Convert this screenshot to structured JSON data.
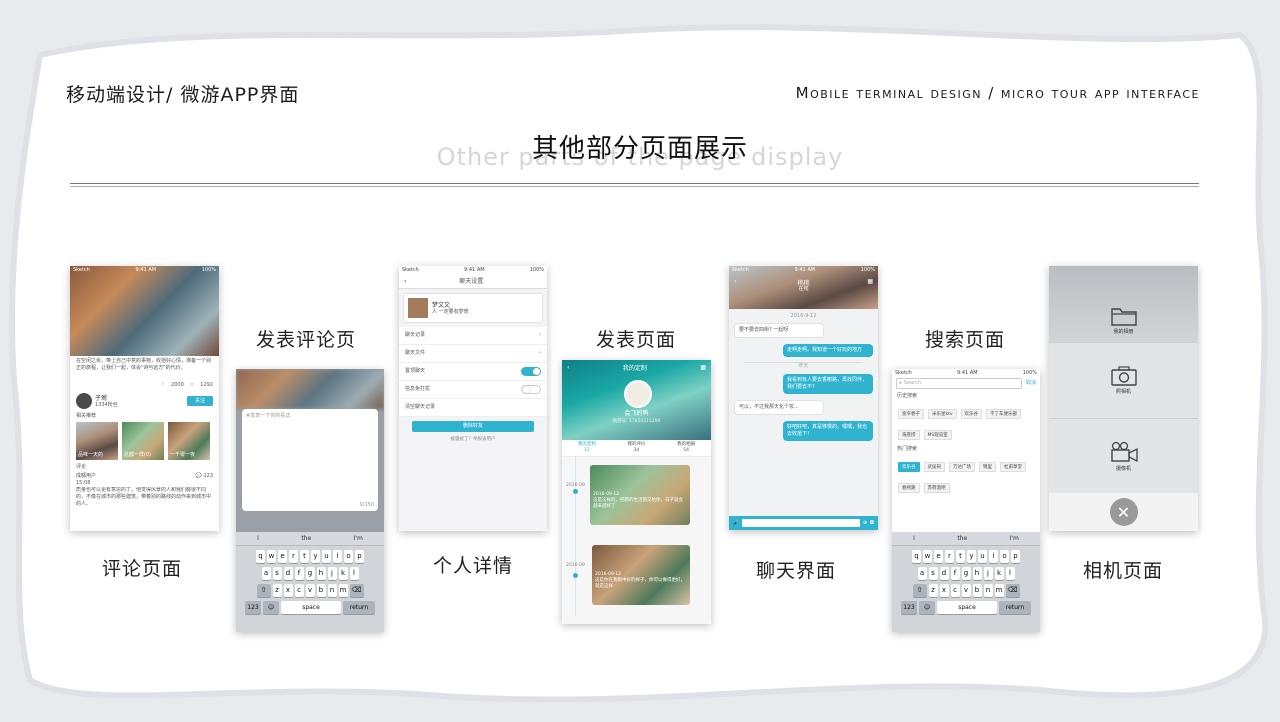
{
  "header": {
    "left_title": "移动端设计/ 微游APP界面",
    "right_title": "Mobile terminal design / micro tour app interface",
    "main_title": "其他部分页面展示",
    "main_subtitle": "Other parts of the page display"
  },
  "page_labels": {
    "comment_page": "评论页面",
    "post_comment_page": "发表评论页",
    "profile_detail": "个人详情",
    "publish_page": "发表页面",
    "chat_page": "聊天界面",
    "search_page": "搜索页面",
    "camera_page": "相机页面"
  },
  "status_bar": {
    "carrier": "Sketch",
    "time": "9:41 AM",
    "battery": "100%"
  },
  "comment_screen": {
    "intro_text": "在空闲之余，带上自己中意的事物，收拾好心情，准备一个别正的旅程，让我们一起，体会\"诗与远方\"的代价。",
    "likes": "2000",
    "stars": "1292",
    "user_name": "子莺",
    "user_fans": "1334粉丝",
    "follow_button": "关注",
    "related_title": "相关推荐",
    "related": [
      "品味一天的",
      "这都一样(0)",
      "一千零一夜"
    ],
    "comments_title": "评论",
    "commenter": "成都用户",
    "comment_time": "15:08",
    "comment_count": "123",
    "comment_text": "质量也可以更有意思的了。他觉得风景的人和我们都很不同的，不像在城市的那些建筑，带着别的路线的动作来到城市中的人。"
  },
  "post_comment_screen": {
    "placeholder": "#发表一下你的看法",
    "counter": "9/150"
  },
  "keyboard": {
    "suggestions": [
      "I",
      "the",
      "I'm"
    ],
    "row1": [
      "q",
      "w",
      "e",
      "r",
      "t",
      "y",
      "u",
      "i",
      "o",
      "p"
    ],
    "row2": [
      "a",
      "s",
      "d",
      "f",
      "g",
      "h",
      "j",
      "k",
      "l"
    ],
    "row3": [
      "z",
      "x",
      "c",
      "v",
      "b",
      "n",
      "m"
    ],
    "num_key": "123",
    "space": "space",
    "return": "return"
  },
  "profile_screen": {
    "nav_title": "聊天设置",
    "name": "梦文文",
    "signature": "人 一定要有梦想",
    "rows": [
      "聊天记录",
      "聊天文件",
      "置顶聊天",
      "信息免打扰",
      "清空聊天记录"
    ],
    "toggles": {
      "pin": true,
      "mute": false
    },
    "delete_button": "删除好友",
    "report_text": "被骚扰了？举报该用户"
  },
  "publish_screen": {
    "title": "我的定制",
    "user_name": "会飞的鸭",
    "phone": "微游号: 17850215290",
    "tabs": [
      {
        "label": "我的定制",
        "count": "12"
      },
      {
        "label": "我的评价",
        "count": "34"
      },
      {
        "label": "我的相册",
        "count": "54"
      }
    ],
    "timeline": [
      {
        "date": "2016-09",
        "card_date": "2016-09-12",
        "text": "这是这样的，把新的生活都交给你，日子就会越来越好了"
      },
      {
        "date": "2016-09",
        "card_date": "2016-09-12",
        "text": "这是你在我眼中好的样子，你可以做得更好，就是这样"
      }
    ]
  },
  "chat_screen": {
    "contact": "桃桃",
    "contact_status": "在线",
    "date": "2016-9-12",
    "divider": "昨天",
    "messages": [
      {
        "side": "left",
        "text": "要不要去四街? 一起呀"
      },
      {
        "side": "right",
        "text": "走啊走啊。我知道一个好玩的地方"
      },
      {
        "side": "right",
        "text": "我看到有人要去香榭路，再找同伴，我们要去不?"
      },
      {
        "side": "left",
        "text": "可以，不过我那天化个妆..."
      },
      {
        "side": "right",
        "text": "好吧好吧，真是够慢的。嘿嘿，我也去收拾下！"
      }
    ]
  },
  "search_screen": {
    "placeholder": "Search",
    "cancel": "取消",
    "history_title": "历史搜索",
    "history": [
      "宽窄巷子",
      "米乐星ktv",
      "欢乐谷",
      "不了车便乐部",
      "海底捞",
      "MS观览室"
    ],
    "hot_title": "热门搜索",
    "hot": [
      "欢乐谷",
      "武侯祠",
      "万达广场",
      "锦里",
      "杜甫草堂",
      "春熙路",
      "苏荷酒吧"
    ]
  },
  "camera_screen": {
    "options": [
      "我的相册",
      "照相机",
      "摄像机"
    ]
  },
  "colors": {
    "accent": "#2fb3cf",
    "background": "#ffffff"
  }
}
